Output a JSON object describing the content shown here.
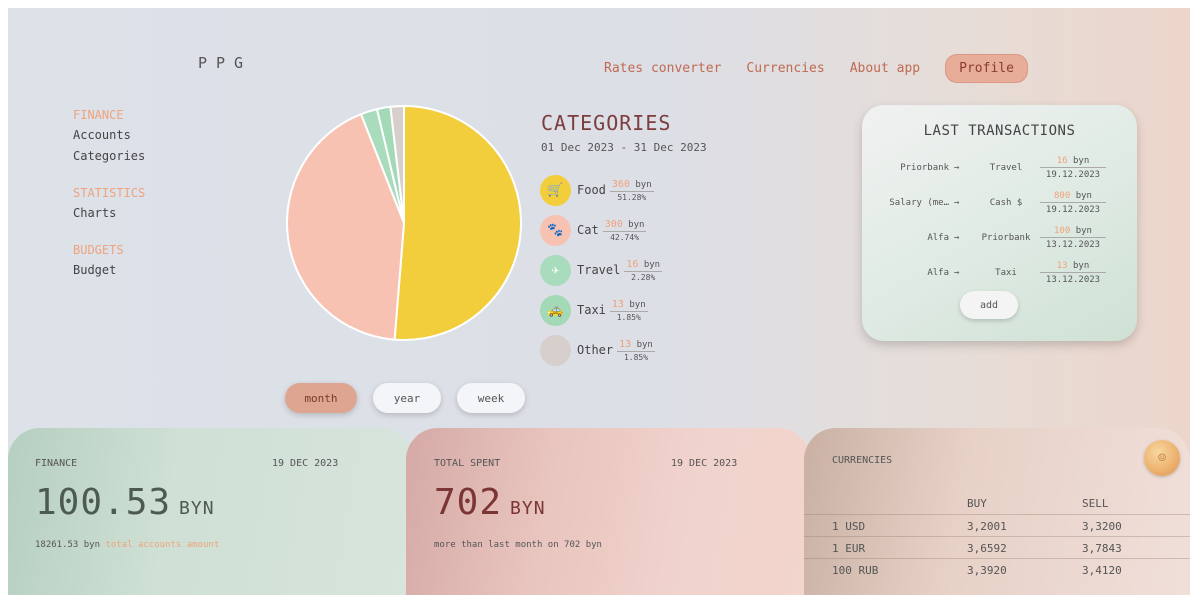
{
  "app": {
    "logo": "PPG"
  },
  "nav": {
    "items": [
      "Rates converter",
      "Currencies",
      "About app"
    ],
    "profile": "Profile"
  },
  "sidebar": {
    "sections": [
      {
        "title": "FINANCE",
        "items": [
          "Accounts",
          "Categories"
        ]
      },
      {
        "title": "STATISTICS",
        "items": [
          "Charts"
        ]
      },
      {
        "title": "BUDGETS",
        "items": [
          "Budget"
        ]
      }
    ]
  },
  "chart_data": {
    "type": "pie",
    "title": "CATEGORIES",
    "subtitle": "01 Dec 2023 - 31 Dec 2023",
    "categories": [
      "Food",
      "Cat",
      "Travel",
      "Taxi",
      "Other"
    ],
    "values": [
      360,
      300,
      16,
      13,
      13
    ],
    "percents": [
      "51.28%",
      "42.74%",
      "2.28%",
      "1.85%",
      "1.85%"
    ],
    "unit": "byn",
    "colors": [
      "#f2cd3c",
      "#f8c2b3",
      "#a9dbbd",
      "#a3d9b6",
      "#d7cfcc"
    ]
  },
  "period": {
    "buttons": [
      "month",
      "year",
      "week"
    ],
    "active": "month"
  },
  "last_transactions": {
    "title": "LAST TRANSACTIONS",
    "rows": [
      {
        "from": "Priorbank",
        "to": "Travel",
        "amount": "16",
        "unit": "byn",
        "date": "19.12.2023"
      },
      {
        "from": "Salary (me…",
        "to": "Cash $",
        "amount": "800",
        "unit": "byn",
        "date": "19.12.2023"
      },
      {
        "from": "Alfa",
        "to": "Priorbank",
        "amount": "100",
        "unit": "byn",
        "date": "13.12.2023"
      },
      {
        "from": "Alfa",
        "to": "Taxi",
        "amount": "13",
        "unit": "byn",
        "date": "13.12.2023"
      }
    ],
    "arrow": "→",
    "add_label": "add"
  },
  "finance": {
    "label": "FINANCE",
    "date": "19 DEC 2023",
    "amount": "100.53",
    "unit": "BYN",
    "sub_value": "18261.53 byn",
    "sub_text": "total accounts amount"
  },
  "spent": {
    "label": "TOTAL SPENT",
    "date": "19 DEC 2023",
    "amount": "702",
    "unit": "BYN",
    "sub_text": "more than last month on 702 byn"
  },
  "currencies": {
    "label": "CURRENCIES",
    "headers": [
      "BUY",
      "SELL"
    ],
    "rows": [
      {
        "name": "1 USD",
        "buy": "3,2001",
        "sell": "3,3200"
      },
      {
        "name": "1 EUR",
        "buy": "3,6592",
        "sell": "3,7843"
      },
      {
        "name": "100 RUB",
        "buy": "3,3920",
        "sell": "3,4120"
      }
    ]
  }
}
